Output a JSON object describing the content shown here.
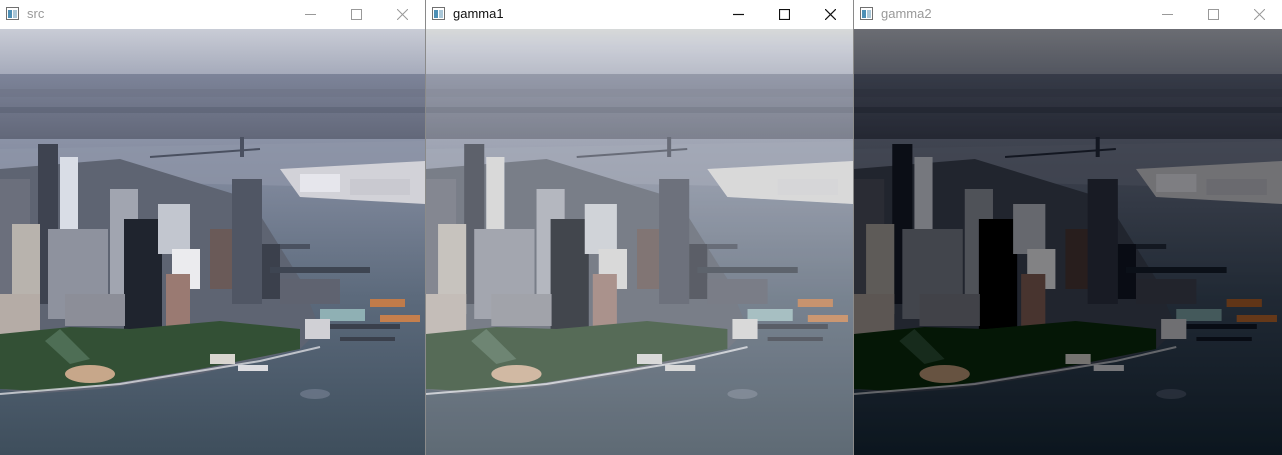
{
  "windows": [
    {
      "title": "src",
      "active": false,
      "image": "harbor-city-aerial-original",
      "controls": [
        "minimize-icon",
        "maximize-icon",
        "close-icon"
      ]
    },
    {
      "title": "gamma1",
      "active": true,
      "image": "harbor-city-aerial-brightened",
      "controls": [
        "minimize-icon",
        "maximize-icon",
        "close-icon"
      ]
    },
    {
      "title": "gamma2",
      "active": false,
      "image": "harbor-city-aerial-darkened",
      "controls": [
        "minimize-icon",
        "maximize-icon",
        "close-icon"
      ]
    }
  ],
  "colors": {
    "titlebar_bg": "#ffffff",
    "inactive_title": "#999999",
    "active_title": "#111111",
    "window_border": "#8a8a8a"
  }
}
